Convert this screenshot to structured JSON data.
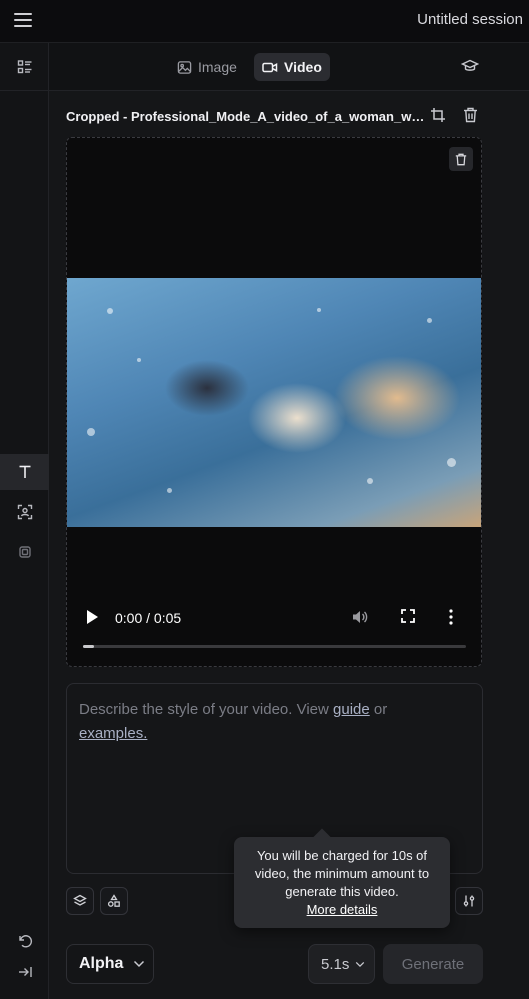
{
  "topbar": {
    "session_title": "Untitled session"
  },
  "tabs": [
    {
      "label": "Image"
    },
    {
      "label": "Video"
    }
  ],
  "media": {
    "file_name": "Cropped - Professional_Mode_A_video_of_a_woman_wearing_a_flowing_dress_underwater.mp4",
    "time_label": "0:00 / 0:05",
    "progress": 0.03
  },
  "prompt": {
    "placeholder_start": "Describe the style of your video. View ",
    "guide_link": "guide",
    "middle": " or ",
    "examples_link": "examples."
  },
  "tooltip": {
    "text": "You will be charged for 10s of video, the minimum amount to generate this video.",
    "link": "More details"
  },
  "footer": {
    "model": "Alpha",
    "duration": "5.1s",
    "generate_label": "Generate"
  },
  "colors": {
    "accent_bg": "#2b2c31",
    "background": "#151618"
  }
}
